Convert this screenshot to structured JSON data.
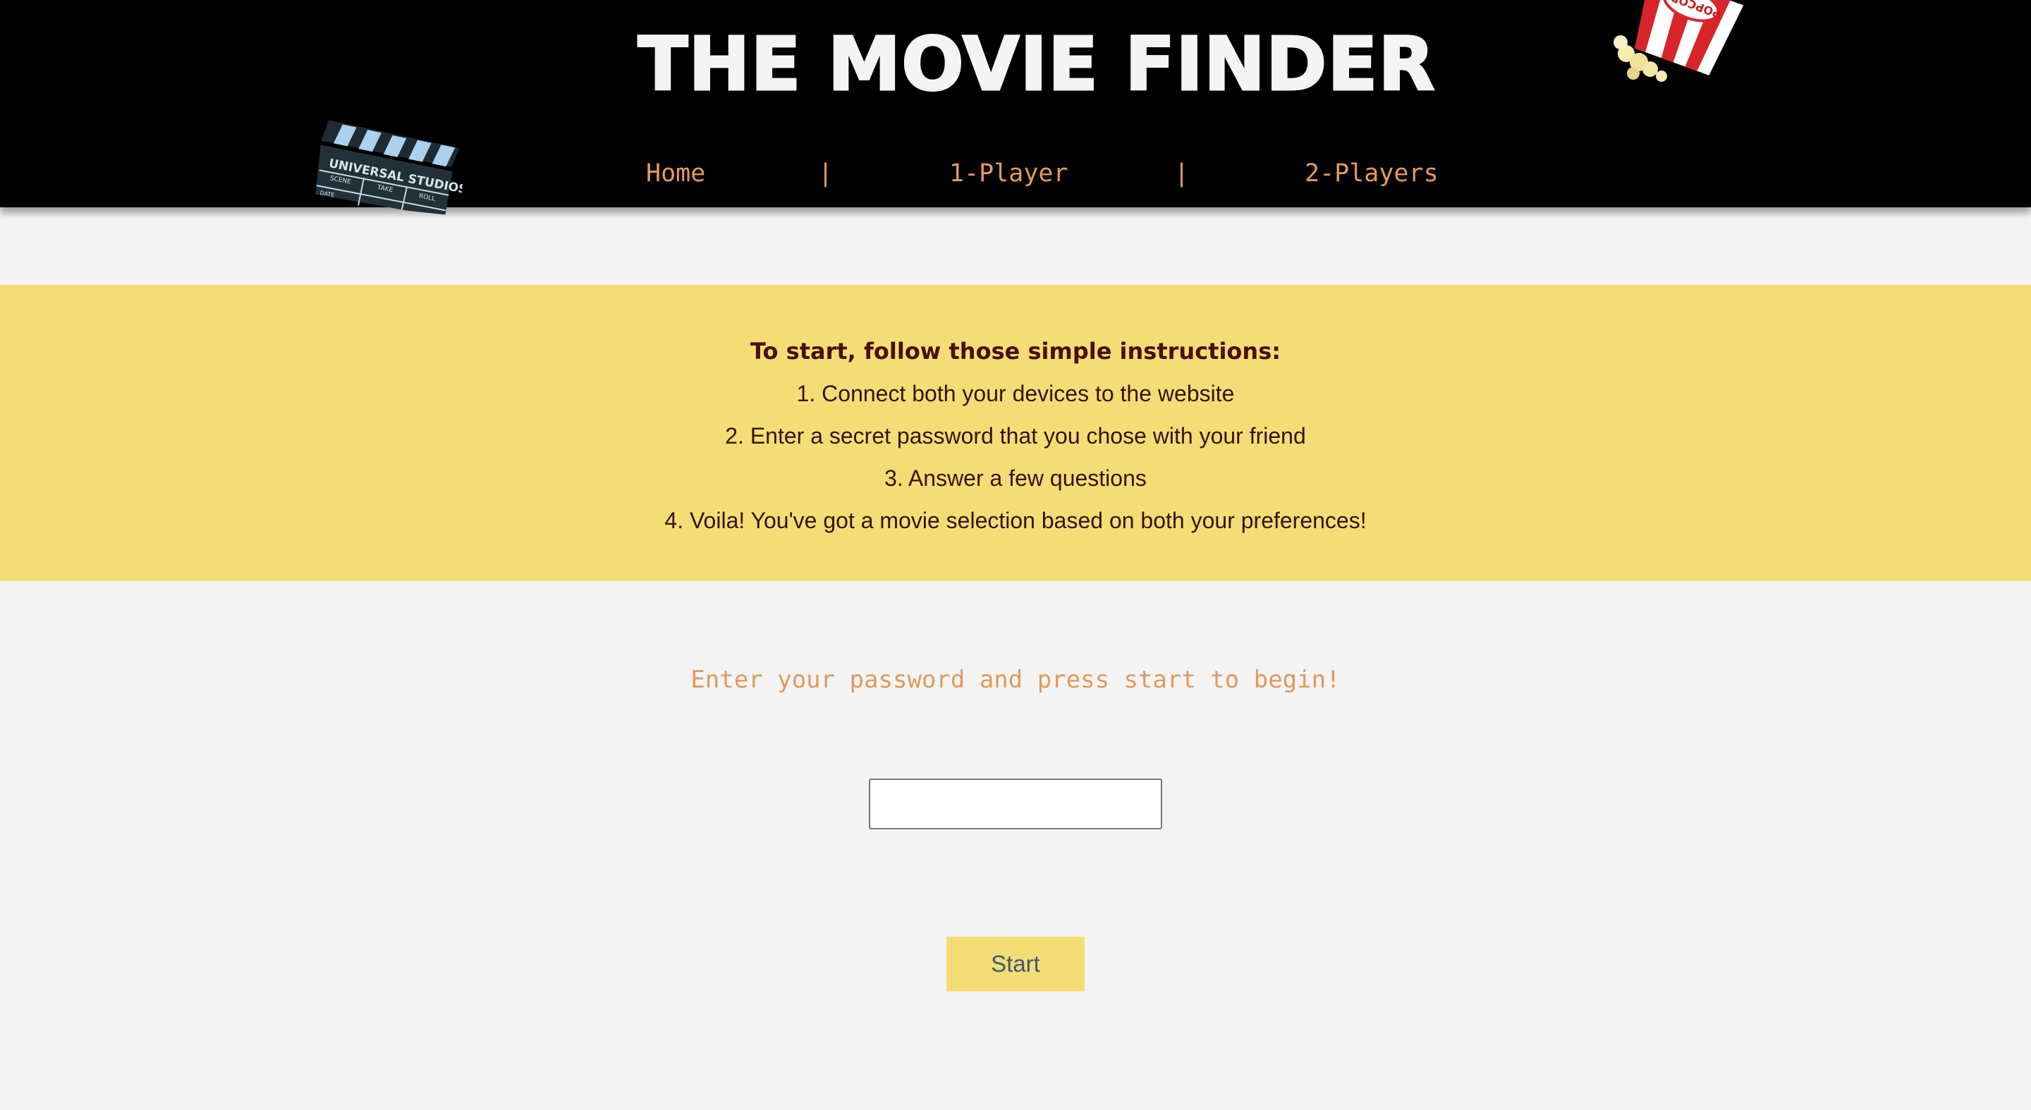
{
  "header": {
    "title": "THE MOVIE FINDER",
    "nav": {
      "home": "Home",
      "one_player": "1-Player",
      "two_players": "2-Players",
      "separator": "|"
    },
    "clapperboard": {
      "icon": "clapperboard-icon",
      "text_studio": "UNIVERSAL STUDIOS",
      "text_scene": "SCENE",
      "text_take": "TAKE",
      "text_roll": "ROLL",
      "text_date": "DATE"
    },
    "popcorn": {
      "icon": "popcorn-icon",
      "text": "POPCORN"
    }
  },
  "instructions": {
    "heading": "To start, follow those simple instructions:",
    "steps": [
      "1. Connect both your devices to the website",
      "2. Enter a secret password that you chose with your friend",
      "3. Answer a few questions",
      "4. Voila! You've got a movie selection based on both your preferences!"
    ]
  },
  "form": {
    "prompt": "Enter your password and press start to begin!",
    "password_value": "",
    "start_label": "Start"
  },
  "colors": {
    "header_bg": "#000000",
    "nav_text": "#e19a5b",
    "banner_bg": "#f5dd76",
    "banner_text": "#3a1111",
    "page_bg": "#f4f4f4",
    "button_text": "#3f5a70"
  }
}
